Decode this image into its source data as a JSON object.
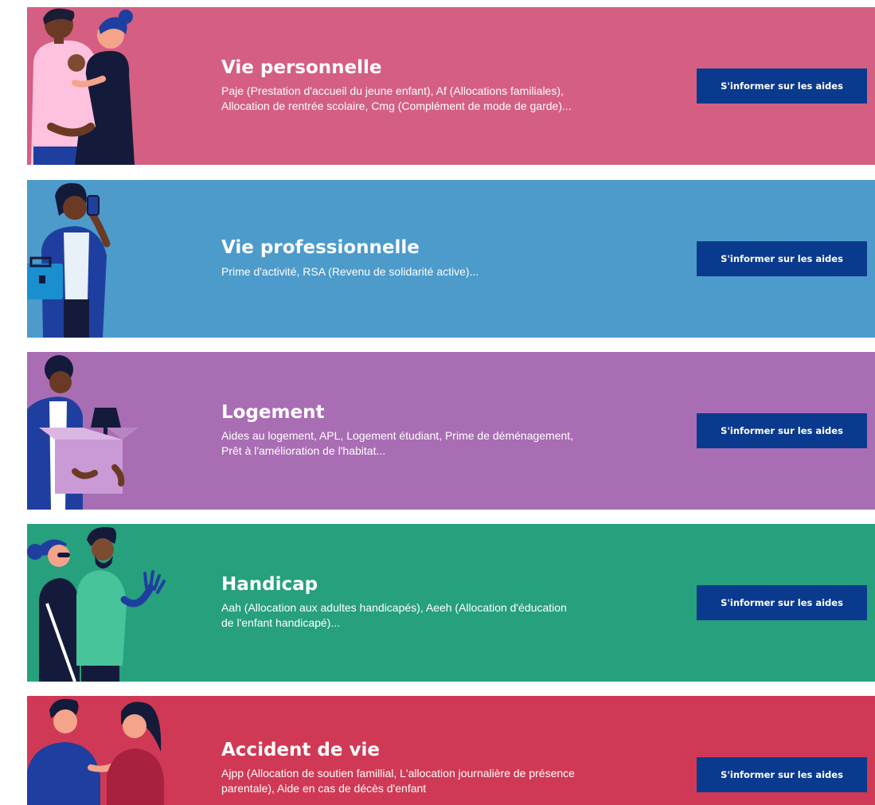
{
  "button_color": "#0a3a8e",
  "cards": [
    {
      "title": "Vie personnelle",
      "desc_line1": "Paje (Prestation d'accueil du jeune enfant), Af (Allocations familiales),",
      "desc_line2": "Allocation de rentrée scolaire, Cmg (Complément de mode de garde)...",
      "button": "S'informer sur les aides",
      "color": "#d45f82",
      "illustration": "family-illustration"
    },
    {
      "title": "Vie professionnelle",
      "desc_line1": "Prime d'activité, RSA (Revenu de solidarité active)...",
      "desc_line2": "",
      "button": "S'informer sur les aides",
      "color": "#4c9bcb",
      "illustration": "professional-illustration"
    },
    {
      "title": "Logement",
      "desc_line1": "Aides au logement, APL, Logement étudiant, Prime de déménagement,",
      "desc_line2": "Prêt à l'amélioration de l'habitat...",
      "button": "S'informer sur les aides",
      "color": "#a96db4",
      "illustration": "moving-box-illustration"
    },
    {
      "title": "Handicap",
      "desc_line1": "Aah (Allocation aux adultes handicapés), Aeeh (Allocation d'éducation",
      "desc_line2": "de l'enfant handicapé)...",
      "button": "S'informer sur les aides",
      "color": "#26a07d",
      "illustration": "disability-illustration"
    },
    {
      "title": "Accident de vie",
      "desc_line1": "Ajpp (Allocation de soutien famillial, L'allocation journalière de présence",
      "desc_line2": "parentale), Aide en cas de décès d'enfant",
      "button": "S'informer sur les aides",
      "color": "#d03955",
      "illustration": "comfort-illustration"
    }
  ]
}
